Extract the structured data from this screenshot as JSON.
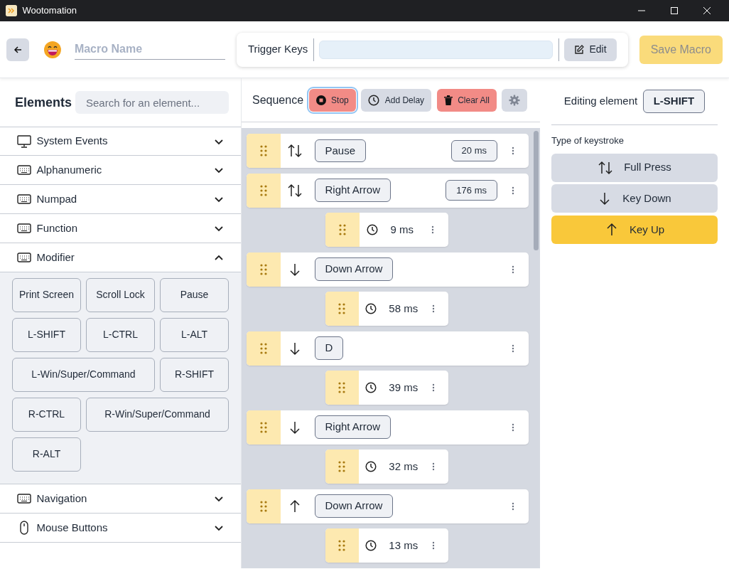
{
  "window": {
    "title": "Wootomation"
  },
  "header": {
    "macro_name_placeholder": "Macro Name",
    "trigger_label": "Trigger Keys",
    "edit_button": "Edit",
    "save_button": "Save Macro",
    "save_disabled": true
  },
  "elements": {
    "title": "Elements",
    "search_placeholder": "Search for an element...",
    "categories": [
      {
        "label": "System Events",
        "kind": "monitor",
        "expanded": false
      },
      {
        "label": "Alphanumeric",
        "kind": "keyboard",
        "expanded": false
      },
      {
        "label": "Numpad",
        "kind": "keyboard",
        "expanded": false
      },
      {
        "label": "Function",
        "kind": "keyboard",
        "expanded": false
      },
      {
        "label": "Modifier",
        "kind": "keyboard",
        "expanded": true,
        "keys": [
          "Print Screen",
          "Scroll Lock",
          "Pause",
          "L-SHIFT",
          "L-CTRL",
          "L-ALT",
          "L-Win/Super/Command",
          "R-SHIFT",
          "R-CTRL",
          "R-Win/Super/Command",
          "R-ALT"
        ]
      },
      {
        "label": "Navigation",
        "kind": "keyboard",
        "expanded": false
      },
      {
        "label": "Mouse Buttons",
        "kind": "mouse",
        "expanded": false
      }
    ]
  },
  "sequence": {
    "title": "Sequence",
    "stop_button": "Stop",
    "add_delay_button": "Add Delay",
    "clear_button": "Clear All",
    "items": [
      {
        "kind": "full_press",
        "key": "Pause",
        "delay": "20 ms"
      },
      {
        "kind": "full_press",
        "key": "Right Arrow",
        "delay": "176 ms"
      },
      {
        "kind": "delay",
        "delay": "9 ms"
      },
      {
        "kind": "key_down",
        "key": "Down Arrow"
      },
      {
        "kind": "delay",
        "delay": "58 ms"
      },
      {
        "kind": "key_down",
        "key": "D"
      },
      {
        "kind": "delay",
        "delay": "39 ms"
      },
      {
        "kind": "key_down",
        "key": "Right Arrow"
      },
      {
        "kind": "delay",
        "delay": "32 ms"
      },
      {
        "kind": "key_up",
        "key": "Down Arrow"
      },
      {
        "kind": "delay",
        "delay": "13 ms"
      }
    ]
  },
  "editor": {
    "label": "Editing element",
    "element": "L-SHIFT",
    "type_label": "Type of keystroke",
    "options": [
      {
        "label": "Full Press",
        "kind": "full_press",
        "selected": false
      },
      {
        "label": "Key Down",
        "kind": "key_down",
        "selected": false
      },
      {
        "label": "Key Up",
        "kind": "key_up",
        "selected": true
      }
    ]
  }
}
